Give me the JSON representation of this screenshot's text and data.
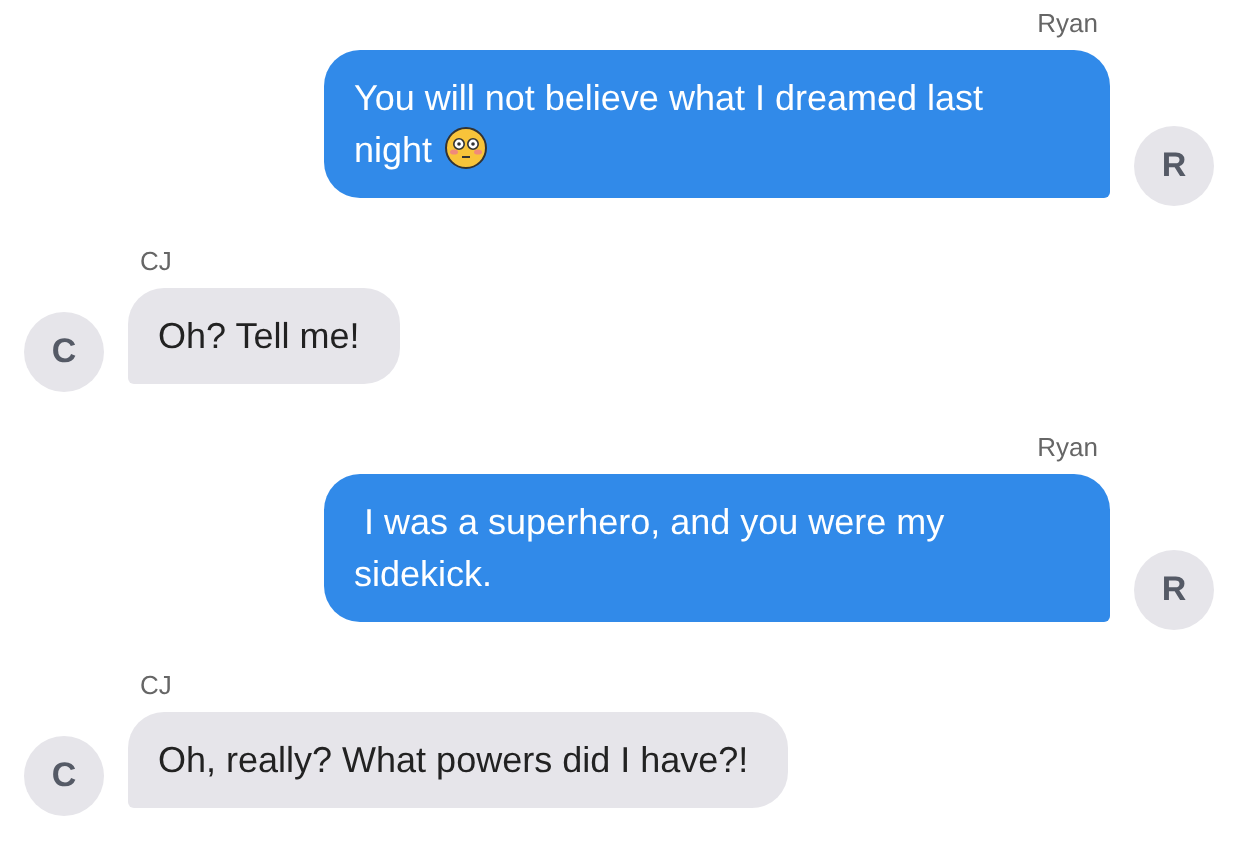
{
  "messages": [
    {
      "sender": "Ryan",
      "initial": "R",
      "outgoing": true,
      "text": "You will not believe what I dreamed last night",
      "has_emoji": true
    },
    {
      "sender": "CJ",
      "initial": "C",
      "outgoing": false,
      "text": "Oh? Tell me!",
      "has_emoji": false
    },
    {
      "sender": "Ryan",
      "initial": "R",
      "outgoing": true,
      "text": " I was a superhero, and you were my sidekick.",
      "has_emoji": false
    },
    {
      "sender": "CJ",
      "initial": "C",
      "outgoing": false,
      "text": "Oh, really? What powers did I have?!",
      "has_emoji": false
    }
  ]
}
